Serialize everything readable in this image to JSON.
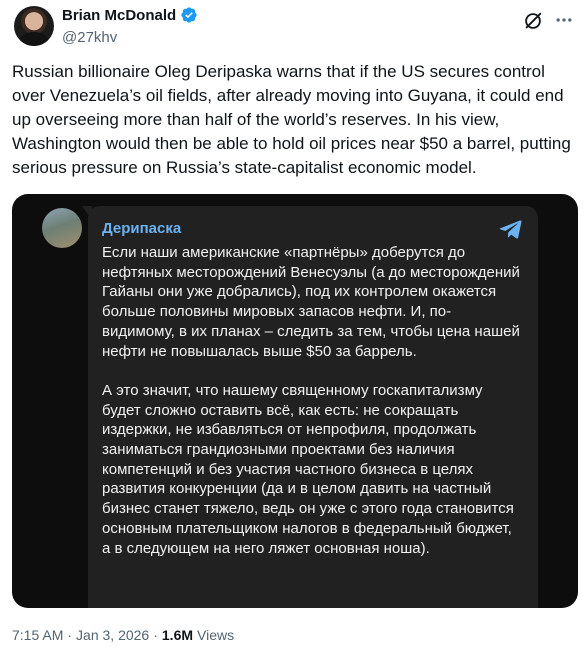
{
  "author": {
    "display_name": "Brian McDonald",
    "handle": "@27khv",
    "verified": true
  },
  "tweet": {
    "text": "Russian billionaire Oleg Deripaska warns that if the US secures control over Venezuela’s oil fields, after already moving into Guyana,  it could end up overseeing more than half of the world’s reserves. In his view, Washington would then be able to hold oil prices near $50 a barrel, putting serious pressure on Russia’s state-capitalist economic model."
  },
  "media": {
    "channel_name": "Дерипаска",
    "message": "Если наши американские «партнёры» доберутся до нефтяных месторождений Венесуэлы (а до месторождений Гайаны они уже добрались), под их контролем окажется больше половины мировых запасов нефти. И, по-видимому, в их планах – следить за тем, чтобы цена нашей нефти не повышалась выше $50 за баррель.\n\nА это значит, что нашему священному госкапитализму будет сложно оставить всё, как есть: не сокращать издержки, не избавляться от непрофиля, продолжать заниматься грандиозными проектами без наличия компетенций и без участия частного бизнеса в целях развития конкуренции (да и в целом давить на частный бизнес станет тяжело, ведь он уже с этого года становится основным плательщиком налогов в федеральный бюджет, а в следующем на него ляжет основная ноша)."
  },
  "meta": {
    "time": "7:15 AM",
    "separator": "·",
    "date": "Jan 3, 2026",
    "views_count": "1.6M",
    "views_label": "Views"
  },
  "colors": {
    "verified": "#1d9bf0",
    "secondary_text": "#536471",
    "telegram_blue": "#6ab2f2"
  },
  "icons": [
    "verified-badge-icon",
    "grok-icon",
    "more-icon",
    "telegram-icon"
  ]
}
